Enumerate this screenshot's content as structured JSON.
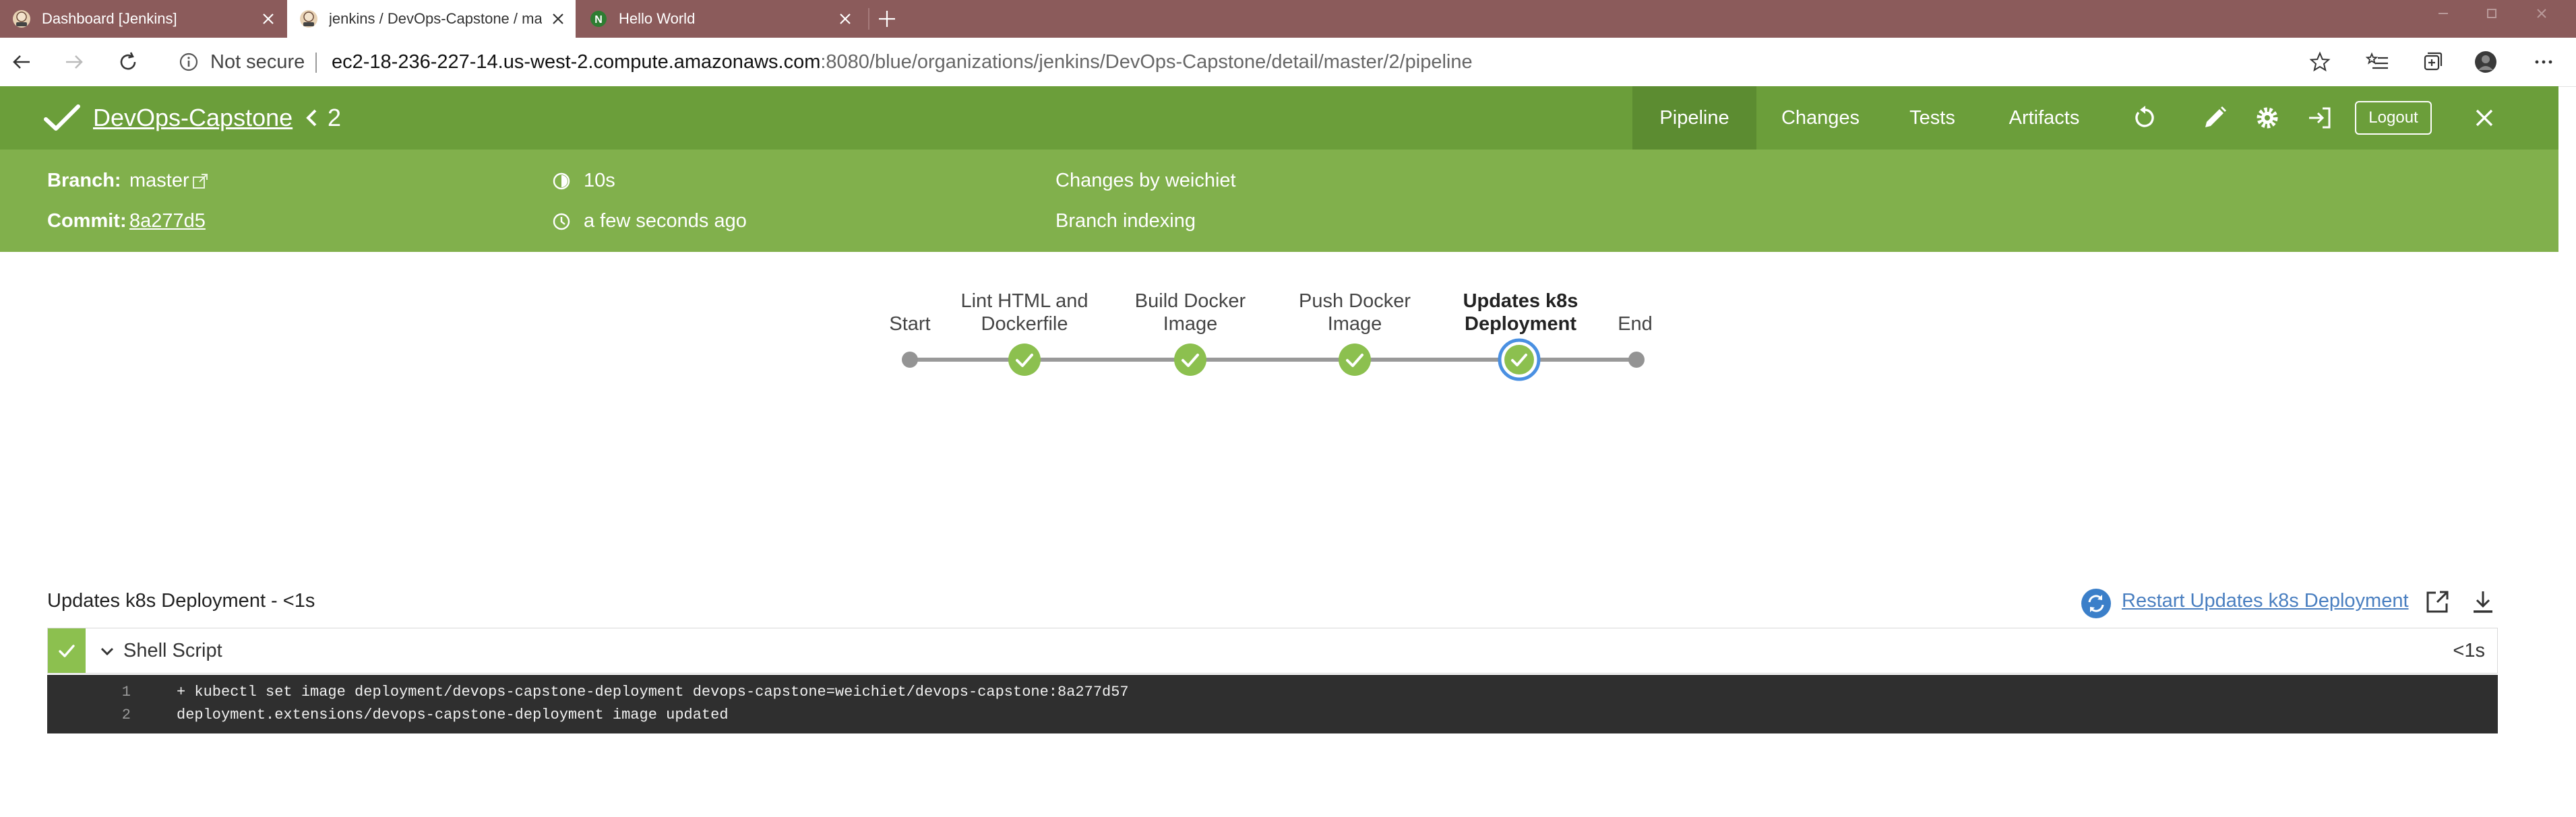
{
  "browser": {
    "tabs": [
      {
        "title": "Dashboard [Jenkins]",
        "favicon": "jenkins-icon",
        "active": false
      },
      {
        "title": "jenkins / DevOps-Capstone / ma",
        "favicon": "jenkins-icon",
        "active": true
      },
      {
        "title": "Hello World",
        "favicon": "n-app-icon",
        "active": false
      }
    ],
    "security_label": "Not secure",
    "url_host": "ec2-18-236-227-14.us-west-2.compute.amazonaws.com",
    "url_rest": ":8080/blue/organizations/jenkins/DevOps-Capstone/detail/master/2/pipeline"
  },
  "header": {
    "project_name": "DevOps-Capstone",
    "run_number": "2",
    "status": "success",
    "tabs": [
      "Pipeline",
      "Changes",
      "Tests",
      "Artifacts"
    ],
    "active_tab": "Pipeline",
    "logout_label": "Logout"
  },
  "subheader": {
    "branch_label": "Branch:",
    "branch_value": "master",
    "commit_label": "Commit:",
    "commit_value": "8a277d5",
    "duration": "10s",
    "time_ago": "a few seconds ago",
    "changes_by": "Changes by weichiet",
    "cause": "Branch indexing"
  },
  "pipeline": {
    "stages": [
      {
        "label_lines": [
          "Start"
        ],
        "status": "start",
        "selected": false
      },
      {
        "label_lines": [
          "Lint HTML and",
          "Dockerfile"
        ],
        "status": "success",
        "selected": false
      },
      {
        "label_lines": [
          "Build Docker",
          "Image"
        ],
        "status": "success",
        "selected": false
      },
      {
        "label_lines": [
          "Push Docker",
          "Image"
        ],
        "status": "success",
        "selected": false
      },
      {
        "label_lines": [
          "Updates k8s",
          "Deployment"
        ],
        "status": "success",
        "selected": true
      },
      {
        "label_lines": [
          "End"
        ],
        "status": "end",
        "selected": false
      }
    ]
  },
  "stage_detail": {
    "title": "Updates k8s Deployment - <1s",
    "restart_label": "Restart Updates k8s Deployment",
    "step": {
      "title": "Shell Script",
      "duration": "<1s",
      "status": "success"
    },
    "log_lines": [
      {
        "num": "1",
        "text": "+ kubectl set image deployment/devops-capstone-deployment devops-capstone=weichiet/devops-capstone:8a277d57"
      },
      {
        "num": "2",
        "text": "deployment.extensions/devops-capstone-deployment image updated"
      }
    ]
  },
  "colors": {
    "header_green": "#6b9e3a",
    "subheader_green": "#81b04c",
    "success_green": "#8cc04f",
    "selected_ring": "#4a90e2",
    "tabstrip": "#8b5b5b",
    "log_bg": "#2f2f2f"
  }
}
